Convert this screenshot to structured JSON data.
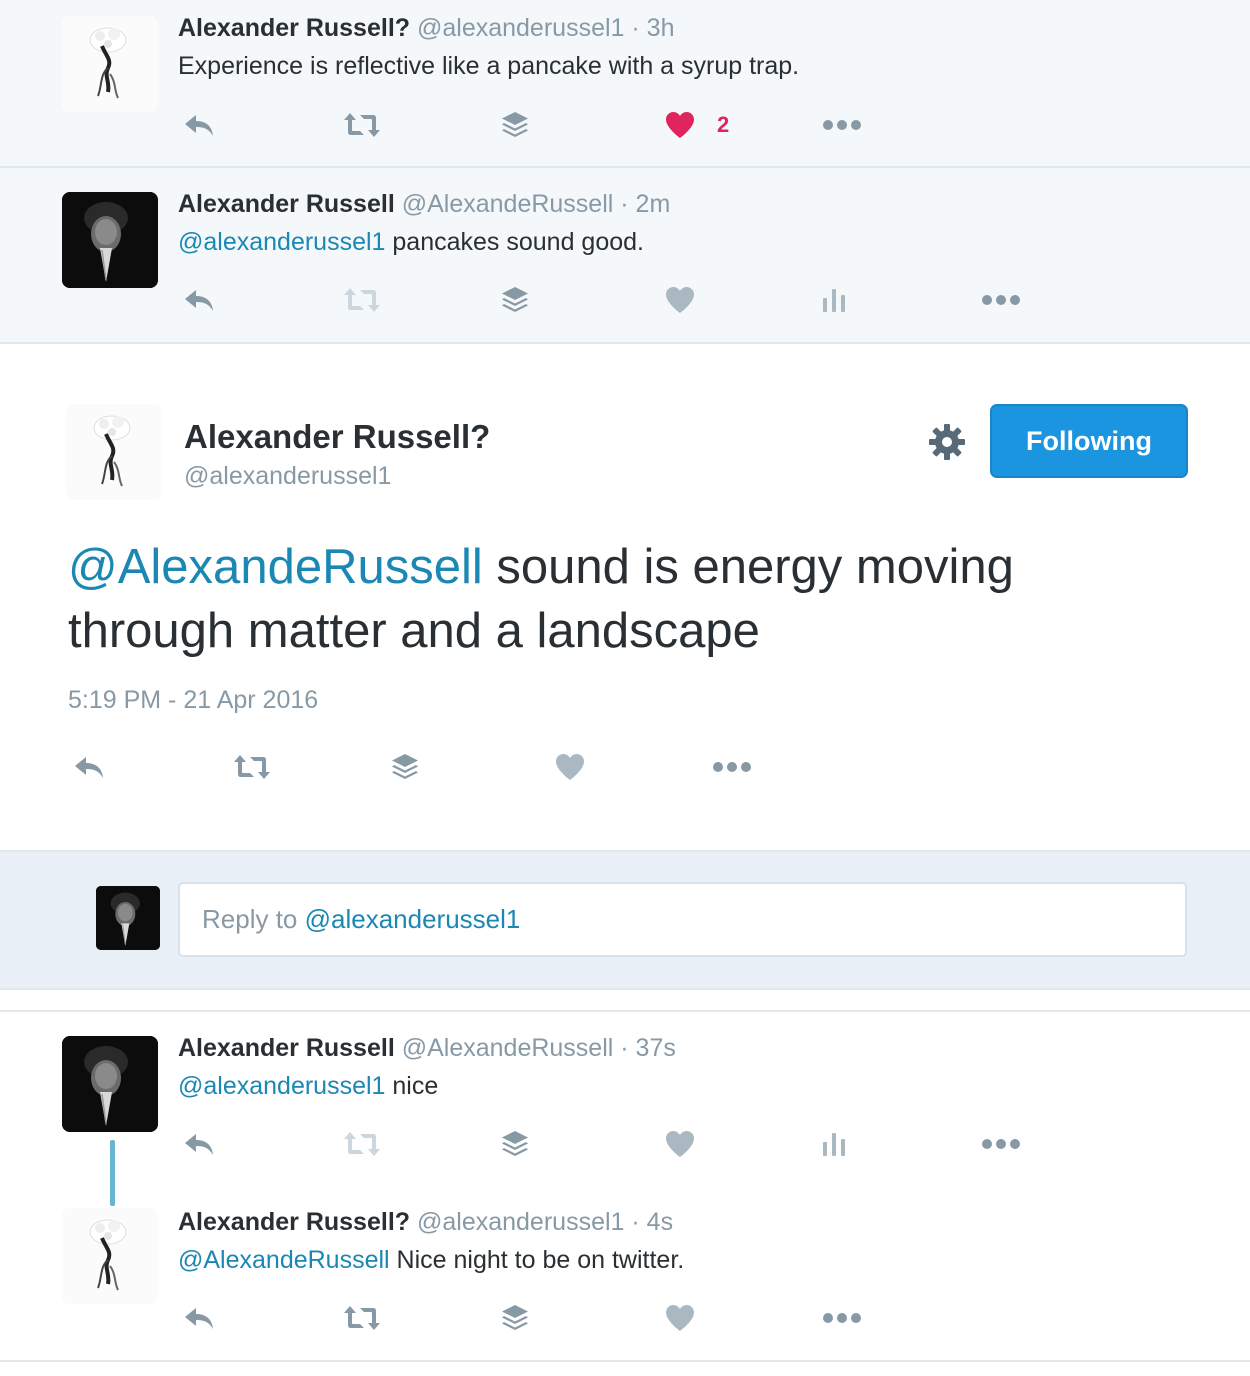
{
  "tweets": [
    {
      "name": "Alexander Russell?",
      "handle": "@alexanderussel1",
      "time": "· 3h",
      "mention": "",
      "text": "Experience is reflective like a pancake with a syrup trap.",
      "like_count": "2",
      "liked": true,
      "avatar": "white-flower-figure"
    },
    {
      "name": "Alexander Russell",
      "handle": "@AlexandeRussell",
      "time": "· 2m",
      "mention": "@alexanderussel1",
      "text": " pancakes sound good.",
      "avatar": "man-portrait-dark"
    },
    {
      "name": "Alexander Russell",
      "handle": "@AlexandeRussell",
      "time": "· 37s",
      "mention": "@alexanderussel1",
      "text": " nice",
      "avatar": "man-portrait-dark"
    },
    {
      "name": "Alexander Russell?",
      "handle": "@alexanderussel1",
      "time": "· 4s",
      "mention": "@AlexandeRussell",
      "text": " Nice night to be on twitter.",
      "avatar": "white-flower-figure"
    }
  ],
  "focus": {
    "name": "Alexander Russell?",
    "handle": "@alexanderussel1",
    "follow_label": "Following",
    "mention": "@AlexandeRussell",
    "text": " sound is energy moving through matter and a landscape",
    "timestamp": "5:19 PM - 21 Apr 2016"
  },
  "reply": {
    "prefix": "Reply to ",
    "mention": "@alexanderussel1"
  },
  "icons": {
    "reply": "reply-icon",
    "retweet": "retweet-icon",
    "buffer": "buffer-icon",
    "like": "heart-icon",
    "analytics": "analytics-icon",
    "more": "more-icon",
    "settings": "gear-icon"
  },
  "colors": {
    "mention": "#1b88b4",
    "like_active": "#e0245e",
    "follow_button": "#1b95e0",
    "icon_gray": "#8899a6",
    "retweet_disabled": "#ccd6dd"
  }
}
